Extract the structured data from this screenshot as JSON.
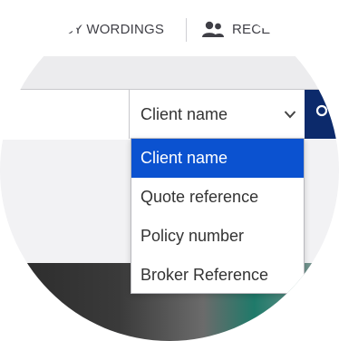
{
  "nav": {
    "wordings_label": "CY WORDINGS",
    "rece_label": "RECE",
    "people_icon": "people-icon"
  },
  "search": {
    "input_value": "",
    "select_value": "Client name",
    "chevron_icon": "chevron-down-icon",
    "search_icon": "search-icon",
    "button_color": "#0c2a6b"
  },
  "dropdown": {
    "selected_color": "#0b52d0",
    "options": [
      {
        "label": "Client name",
        "selected": true
      },
      {
        "label": "Quote reference",
        "selected": false
      },
      {
        "label": "Policy number",
        "selected": false
      },
      {
        "label": "Broker Reference",
        "selected": false
      }
    ]
  }
}
